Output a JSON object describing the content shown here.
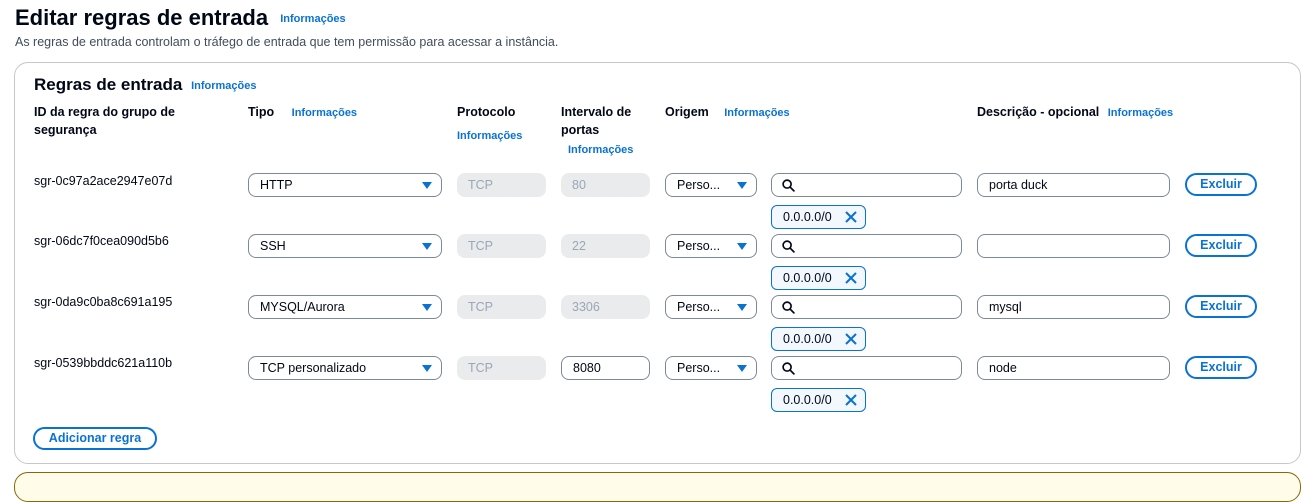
{
  "page": {
    "title": "Editar regras de entrada",
    "info_label": "Informações",
    "description": "As regras de entrada controlam o tráfego de entrada que tem permissão para acessar a instância."
  },
  "panel": {
    "title": "Regras de entrada",
    "info_label": "Informações",
    "columns": {
      "rule_id": "ID da regra do grupo de segurança",
      "type": "Tipo",
      "protocol": "Protocolo",
      "port_range": "Intervalo de portas",
      "source": "Origem",
      "description": "Descrição - opcional"
    },
    "rows": [
      {
        "id": "sgr-0c97a2ace2947e07d",
        "type": "HTTP",
        "protocol": "TCP",
        "port": "80",
        "source_type": "Perso...",
        "search": "",
        "cidr": "0.0.0.0/0",
        "description": "porta duck",
        "delete": "Excluir"
      },
      {
        "id": "sgr-06dc7f0cea090d5b6",
        "type": "SSH",
        "protocol": "TCP",
        "port": "22",
        "source_type": "Perso...",
        "search": "",
        "cidr": "0.0.0.0/0",
        "description": "",
        "delete": "Excluir"
      },
      {
        "id": "sgr-0da9c0ba8c691a195",
        "type": "MYSQL/Aurora",
        "protocol": "TCP",
        "port": "3306",
        "source_type": "Perso...",
        "search": "",
        "cidr": "0.0.0.0/0",
        "description": "mysql",
        "delete": "Excluir"
      },
      {
        "id": "sgr-0539bbddc621a110b",
        "type": "TCP personalizado",
        "protocol": "TCP",
        "port": "8080",
        "source_type": "Perso...",
        "search": "",
        "cidr": "0.0.0.0/0",
        "description": "node",
        "delete": "Excluir"
      }
    ],
    "add_rule": "Adicionar regra"
  },
  "colors": {
    "accent": "#0972d3",
    "text": "#000716",
    "disabled_bg": "#e9ebed",
    "warning_bg": "#fffce9"
  },
  "icons": {
    "search": "search-icon",
    "dismiss": "close-icon",
    "dropdown": "caret-down-icon"
  }
}
